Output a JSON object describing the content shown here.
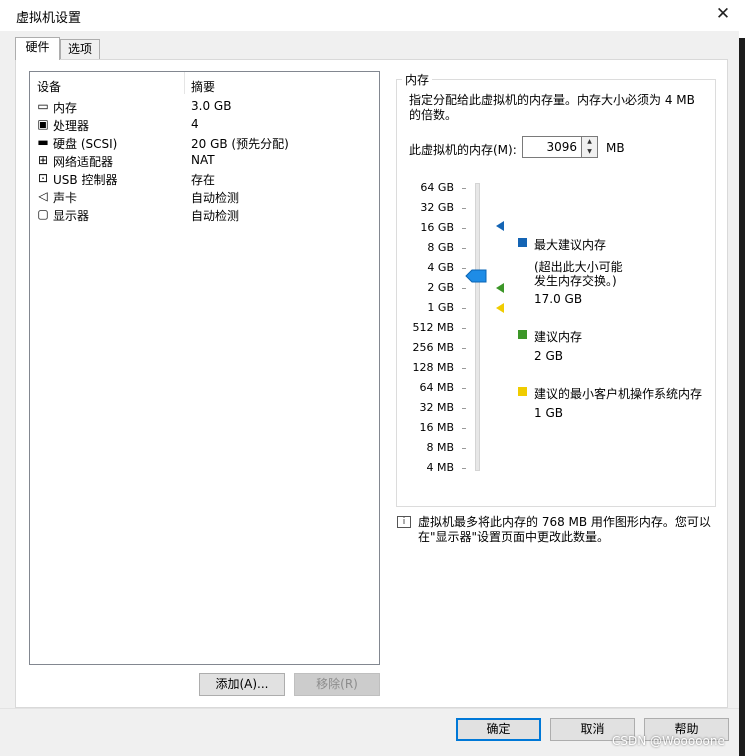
{
  "window": {
    "title": "虚拟机设置",
    "close_glyph": "✕"
  },
  "tabs": [
    {
      "label": "硬件",
      "active": true
    },
    {
      "label": "选项",
      "active": false
    }
  ],
  "device_table": {
    "headers": {
      "device": "设备",
      "summary": "摘要"
    },
    "rows": [
      {
        "icon": "memory-icon",
        "name": "内存",
        "summary": "3.0 GB"
      },
      {
        "icon": "processor-icon",
        "name": "处理器",
        "summary": "4"
      },
      {
        "icon": "hard-disk-icon",
        "name": "硬盘 (SCSI)",
        "summary": "20 GB (预先分配)"
      },
      {
        "icon": "network-adapter-icon",
        "name": "网络适配器",
        "summary": "NAT"
      },
      {
        "icon": "usb-controller-icon",
        "name": "USB 控制器",
        "summary": "存在"
      },
      {
        "icon": "sound-card-icon",
        "name": "声卡",
        "summary": "自动检测"
      },
      {
        "icon": "display-icon",
        "name": "显示器",
        "summary": "自动检测"
      }
    ]
  },
  "list_buttons": {
    "add": "添加(A)...",
    "remove": "移除(R)"
  },
  "memory": {
    "group_title": "内存",
    "description": "指定分配给此虚拟机的内存量。内存大小必须为 4 MB 的倍数。",
    "field_label": "此虚拟机的内存(M):",
    "value": "3096",
    "unit": "MB",
    "slider_scale": [
      "64 GB",
      "32 GB",
      "16 GB",
      "8 GB",
      "4 GB",
      "2 GB",
      "1 GB",
      "512 MB",
      "256 MB",
      "128 MB",
      "64 MB",
      "32 MB",
      "16 MB",
      "8 MB",
      "4 MB"
    ],
    "slider_value_index": 4.4,
    "markers": {
      "max_recommended_index": 1.9,
      "recommended_index": 5,
      "min_guest_index": 6
    },
    "legend": {
      "max": {
        "title": "最大建议内存",
        "note_line1": "(超出此大小可能",
        "note_line2": "发生内存交换。)",
        "value": "17.0 GB",
        "color": "#1464b4"
      },
      "recommended": {
        "title": "建议内存",
        "value": "2 GB",
        "color": "#3c9628"
      },
      "minimum": {
        "title": "建议的最小客户机操作系统内存",
        "value": "1 GB",
        "color": "#f0cc00"
      }
    },
    "thumb_color": "#1e8ce6"
  },
  "info": {
    "line1": "虚拟机最多将此内存的 768 MB 用作图形内存。您可以",
    "line2": "在\"显示器\"设置页面中更改此数量。"
  },
  "footer": {
    "ok": "确定",
    "cancel": "取消",
    "help": "帮助"
  },
  "watermark": "CSDN @Wooooone"
}
